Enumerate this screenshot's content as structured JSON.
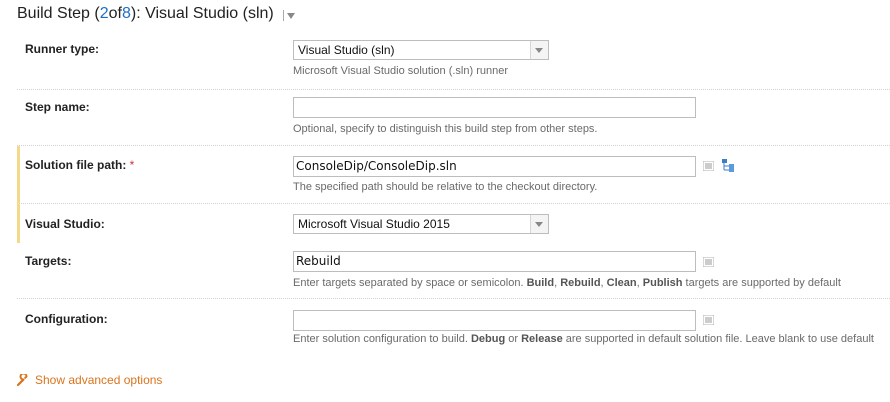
{
  "header": {
    "prefix": "Build Step (",
    "current": "2",
    "of": " of ",
    "total": "8",
    "suffix": "): Visual Studio (sln)"
  },
  "runner_type": {
    "label": "Runner type:",
    "value": "Visual Studio (sln)",
    "hint": "Microsoft Visual Studio solution (.sln) runner"
  },
  "step_name": {
    "label": "Step name:",
    "value": "",
    "hint": "Optional, specify to distinguish this build step from other steps."
  },
  "solution_path": {
    "label": "Solution file path:",
    "required_mark": "*",
    "value": "ConsoleDip/ConsoleDip.sln",
    "hint": "The specified path should be relative to the checkout directory."
  },
  "visual_studio": {
    "label": "Visual Studio:",
    "value": "Microsoft Visual Studio 2015"
  },
  "targets": {
    "label": "Targets:",
    "value": "Rebuild",
    "hint_parts": [
      "Enter targets separated by space or semicolon. ",
      "Build",
      ", ",
      "Rebuild",
      ", ",
      "Clean",
      ", ",
      "Publish",
      " targets are supported by default"
    ]
  },
  "configuration": {
    "label": "Configuration:",
    "value": "",
    "hint_parts": [
      "Enter solution configuration to build. ",
      "Debug",
      " or ",
      "Release",
      " are supported in default solution file. Leave blank to use default"
    ]
  },
  "advanced": {
    "label": "Show advanced options"
  },
  "colors": {
    "accent": "#1e6ec8",
    "link_orange": "#d9741c",
    "required_bar": "#f5d98a",
    "required_star": "#cc3333"
  }
}
